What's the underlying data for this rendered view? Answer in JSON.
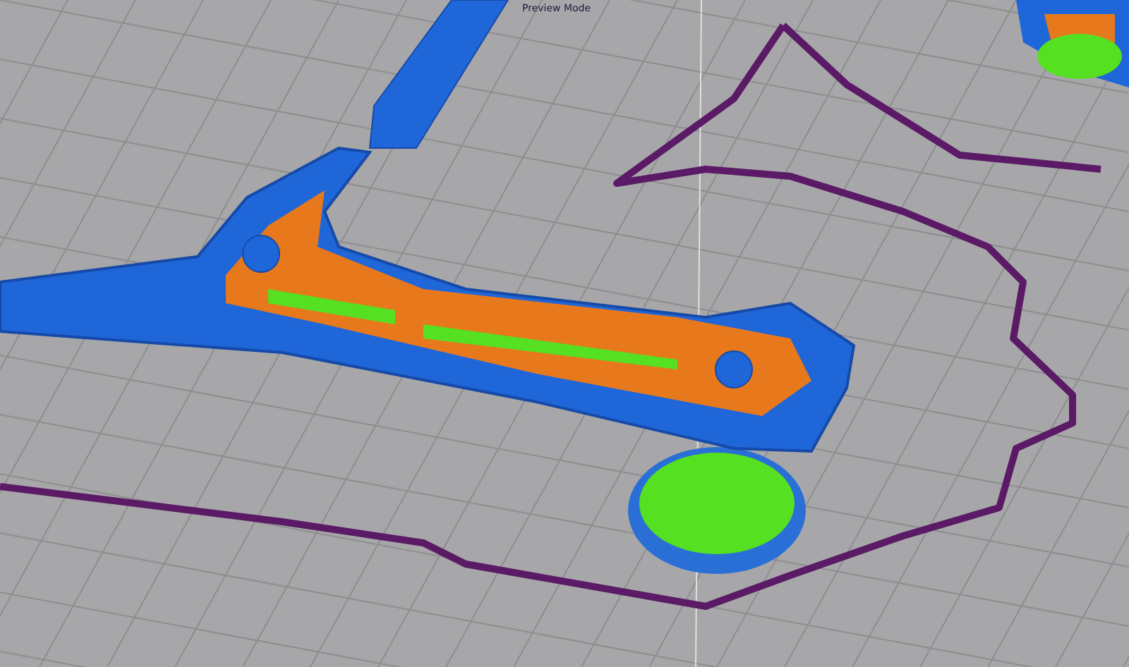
{
  "viewport": {
    "label": "Preview Mode"
  }
}
